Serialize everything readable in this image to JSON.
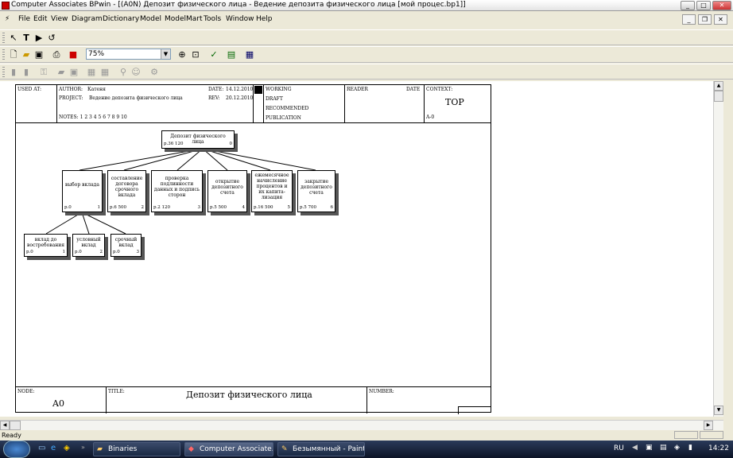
{
  "window": {
    "title": "Computer Associates BPwin - [(A0N) Депозит физического лица - Ведение депозита физического лица  [мой процес.bp1]]"
  },
  "menu": [
    "File",
    "Edit",
    "View",
    "Diagram",
    "Dictionary",
    "Model",
    "ModelMart",
    "Tools",
    "Window",
    "Help"
  ],
  "toolbar": {
    "zoom": "75%"
  },
  "frame": {
    "used_at": "USED AT:",
    "author_label": "AUTHOR:",
    "author": "Катеня",
    "project_label": "PROJECT:",
    "project": "Ведение депозита физического лица",
    "notes": "NOTES:  1  2  3  4  5  6  7  8  9  10",
    "date_label": "DATE:",
    "date": "14.12.2010",
    "rev_label": "REV:",
    "rev": "20.12.2010",
    "working": "WORKING",
    "draft": "DRAFT",
    "recommended": "RECOMMENDED",
    "publication": "PUBLICATION",
    "reader": "READER",
    "date2": "DATE",
    "context_label": "CONTEXT:",
    "context": "TOP",
    "context_node": "A-0",
    "node_label": "NODE:",
    "node": "A0",
    "title_label": "TITLE:",
    "title": "Депозит физического лица",
    "number_label": "NUMBER:"
  },
  "nodes": [
    {
      "text": "Депозит физического лица",
      "cost": "р.36 120",
      "num": "0"
    },
    {
      "text": "выбор вклада",
      "cost": "р.0",
      "num": "1"
    },
    {
      "text": "составление договора срочного вклада",
      "cost": "р.6 500",
      "num": "2"
    },
    {
      "text": "проверка подлинности данных и подпись сторон",
      "cost": "р.2 120",
      "num": "3"
    },
    {
      "text": "открытие депозитного счета",
      "cost": "р.5 500",
      "num": "4"
    },
    {
      "text": "ежемесячное начисление процентов и их капита-лизация",
      "cost": "р.16 500",
      "num": "5"
    },
    {
      "text": "закрытие депозитного счета",
      "cost": "р.5 700",
      "num": "6"
    },
    {
      "text": "вклад до востребования",
      "cost": "р.0",
      "num": "1"
    },
    {
      "text": "условный вклад",
      "cost": "р.0",
      "num": "2"
    },
    {
      "text": "срочный вклад",
      "cost": "р.0",
      "num": "3"
    }
  ],
  "status": "Ready",
  "taskbar": {
    "tasks": [
      "Binaries",
      "Computer Associate...",
      "Безымянный - Paint"
    ],
    "lang": "RU",
    "time": "14:22"
  }
}
